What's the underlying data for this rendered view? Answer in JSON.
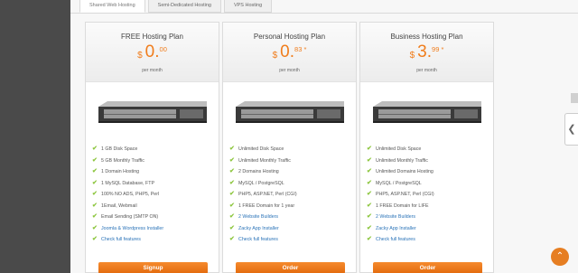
{
  "tabs": [
    "Shared Web Hosting",
    "Semi-Dedicated Hosting",
    "VPS Hosting"
  ],
  "active_tab": 0,
  "colors": {
    "accent": "#f07d1c",
    "check": "#8dc63f",
    "link": "#2a73b8"
  },
  "plans": [
    {
      "title": "FREE Hosting Plan",
      "currency": "$",
      "price_int": "0.",
      "price_cents": "00",
      "per": "per month",
      "features": [
        "1 GB Disk Space",
        "5 GB Monthly Traffic",
        "1 Domain Hosting",
        "1 MySQL Database, FTP",
        "100% NO ADS, PHP5, Perl",
        "1Email, Webmail",
        "Email Sending (SMTP ON)",
        "Joomla & Wordpress Installer",
        "Check full features"
      ],
      "button": "Signup"
    },
    {
      "title": "Personal Hosting Plan",
      "currency": "$",
      "price_int": "0.",
      "price_cents": "83 *",
      "per": "per month",
      "features": [
        "Unlimited Disk Space",
        "Unlimited Monthly Traffic",
        "2 Domains Hosting",
        "MySQL / PostgreSQL",
        "PHP5, ASP.NET, Perl (CGI)",
        "1 FREE Domain for 1 year",
        "2 Website Builders",
        "Zacky App Installer",
        "Check full features"
      ],
      "button": "Order"
    },
    {
      "title": "Business Hosting Plan",
      "currency": "$",
      "price_int": "3.",
      "price_cents": "99 *",
      "per": "per month",
      "features": [
        "Unlimited Disk Space",
        "Unlimited Monthly Traffic",
        "Unlimited Domains Hosting",
        "MySQL / PostgreSQL",
        "PHP5, ASP.NET, Perl (CGI)",
        "1 FREE Domain for LIFE",
        "2 Website Builders",
        "Zacky App Installer",
        "Check full features"
      ],
      "button": "Order"
    }
  ],
  "side_tab_icon": "chevron-left-icon",
  "back_to_top_icon": "chevron-up-icon"
}
